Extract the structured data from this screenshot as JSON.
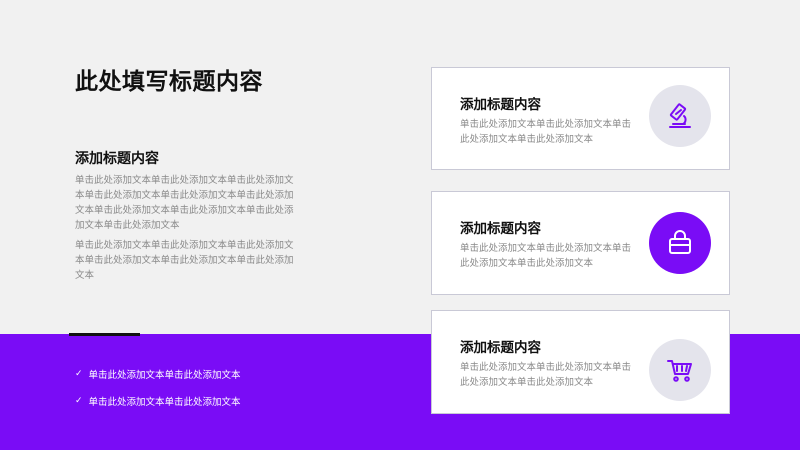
{
  "main_title": "此处填写标题内容",
  "left": {
    "heading": "添加标题内容",
    "paragraphs": [
      "单击此处添加文本单击此处添加文本单击此处添加文本单击此处添加文本单击此处添加文本单击此处添加文本单击此处添加文本单击此处添加文本单击此处添加文本单击此处添加文本",
      "单击此处添加文本单击此处添加文本单击此处添加文本单击此处添加文本单击此处添加文本单击此处添加文本"
    ],
    "checklist": [
      "单击此处添加文本单击此处添加文本",
      "单击此处添加文本单击此处添加文本"
    ]
  },
  "cards": [
    {
      "title": "添加标题内容",
      "text": "单击此处添加文本单击此处添加文本单击此处添加文本单击此处添加文本",
      "icon": "microscope-icon"
    },
    {
      "title": "添加标题内容",
      "text": "单击此处添加文本单击此处添加文本单击此处添加文本单击此处添加文本",
      "icon": "shopping-bag-icon"
    },
    {
      "title": "添加标题内容",
      "text": "单击此处添加文本单击此处添加文本单击此处添加文本单击此处添加文本",
      "icon": "shopping-cart-icon"
    }
  ],
  "colors": {
    "accent": "#7a0cf6",
    "background": "#f1f1f1",
    "icon_bg": "#e4e4ec",
    "text_gray": "#8a8a8a"
  }
}
